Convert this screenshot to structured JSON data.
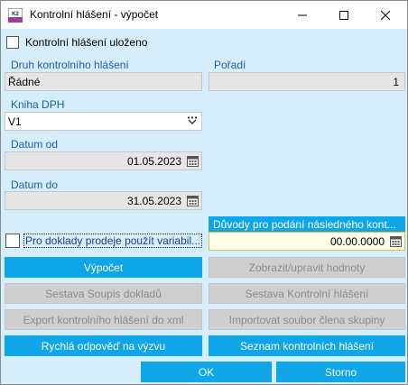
{
  "window": {
    "title": "Kontrolní hlášení - výpočet",
    "app_icon_text": "K2"
  },
  "saved": {
    "label": "Kontrolní hlášení uloženo",
    "checked": false
  },
  "druh": {
    "label": "Druh kontrolního hlášení",
    "value": "Řádné"
  },
  "poradi": {
    "label": "Pořadí",
    "value": "1"
  },
  "kniha": {
    "label": "Kniha DPH",
    "value": "V1"
  },
  "datum_od": {
    "label": "Datum od",
    "value": "01.05.2023"
  },
  "datum_do": {
    "label": "Datum do",
    "value": "31.05.2023"
  },
  "variable": {
    "label": "Pro doklady prodeje použít variabil...",
    "checked": false
  },
  "duvody": {
    "label": "Důvody pro podání následného kont...",
    "value": "00.00.0000"
  },
  "buttons": {
    "vypocet": "Výpočet",
    "zobrazit": "Zobrazit/upravit hodnoty",
    "sestava_soupis": "Sestava Soupis dokladů",
    "sestava_kh": "Sestava Kontrolní hlášení",
    "export": "Export kontrolního hlášení do xml",
    "import": "Importovat soubor člena skupiny",
    "rychla": "Rychlá odpověď na výzvu",
    "seznam": "Seznam kontrolních hlášení",
    "ok": "OK",
    "storno": "Storno"
  },
  "colors": {
    "accent": "#0ea5e9",
    "background": "#d6eefb",
    "label_blue": "#1b5fa8",
    "disabled": "#cfcfcf"
  },
  "icons": {
    "app": "k2-app-icon",
    "minimize": "minimize-icon",
    "maximize": "maximize-icon",
    "close": "close-icon",
    "calendar": "calendar-icon",
    "dropdown": "dropdown-chevron-icon"
  }
}
